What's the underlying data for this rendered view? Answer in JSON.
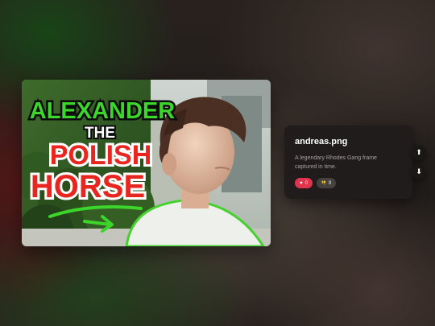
{
  "thumbnail": {
    "line1": "ALEXANDER",
    "line2": "THE",
    "line3": "POLISH",
    "line4": "HORSE"
  },
  "info": {
    "filename": "andreas.png",
    "description": "A legendary Rhodes Gang frame captured in time.",
    "likes": "0",
    "dislikes": "0",
    "like_icon": "heart-icon",
    "dislike_icon": "thumbs-down-icon"
  },
  "nav": {
    "up_icon": "arrow-up-icon",
    "down_icon": "arrow-down-icon"
  },
  "colors": {
    "like": "#e0344d",
    "dislike": "#45413f",
    "panel": "#1f1c1b",
    "title_green": "#3cd52b",
    "title_red": "#e8261f"
  }
}
